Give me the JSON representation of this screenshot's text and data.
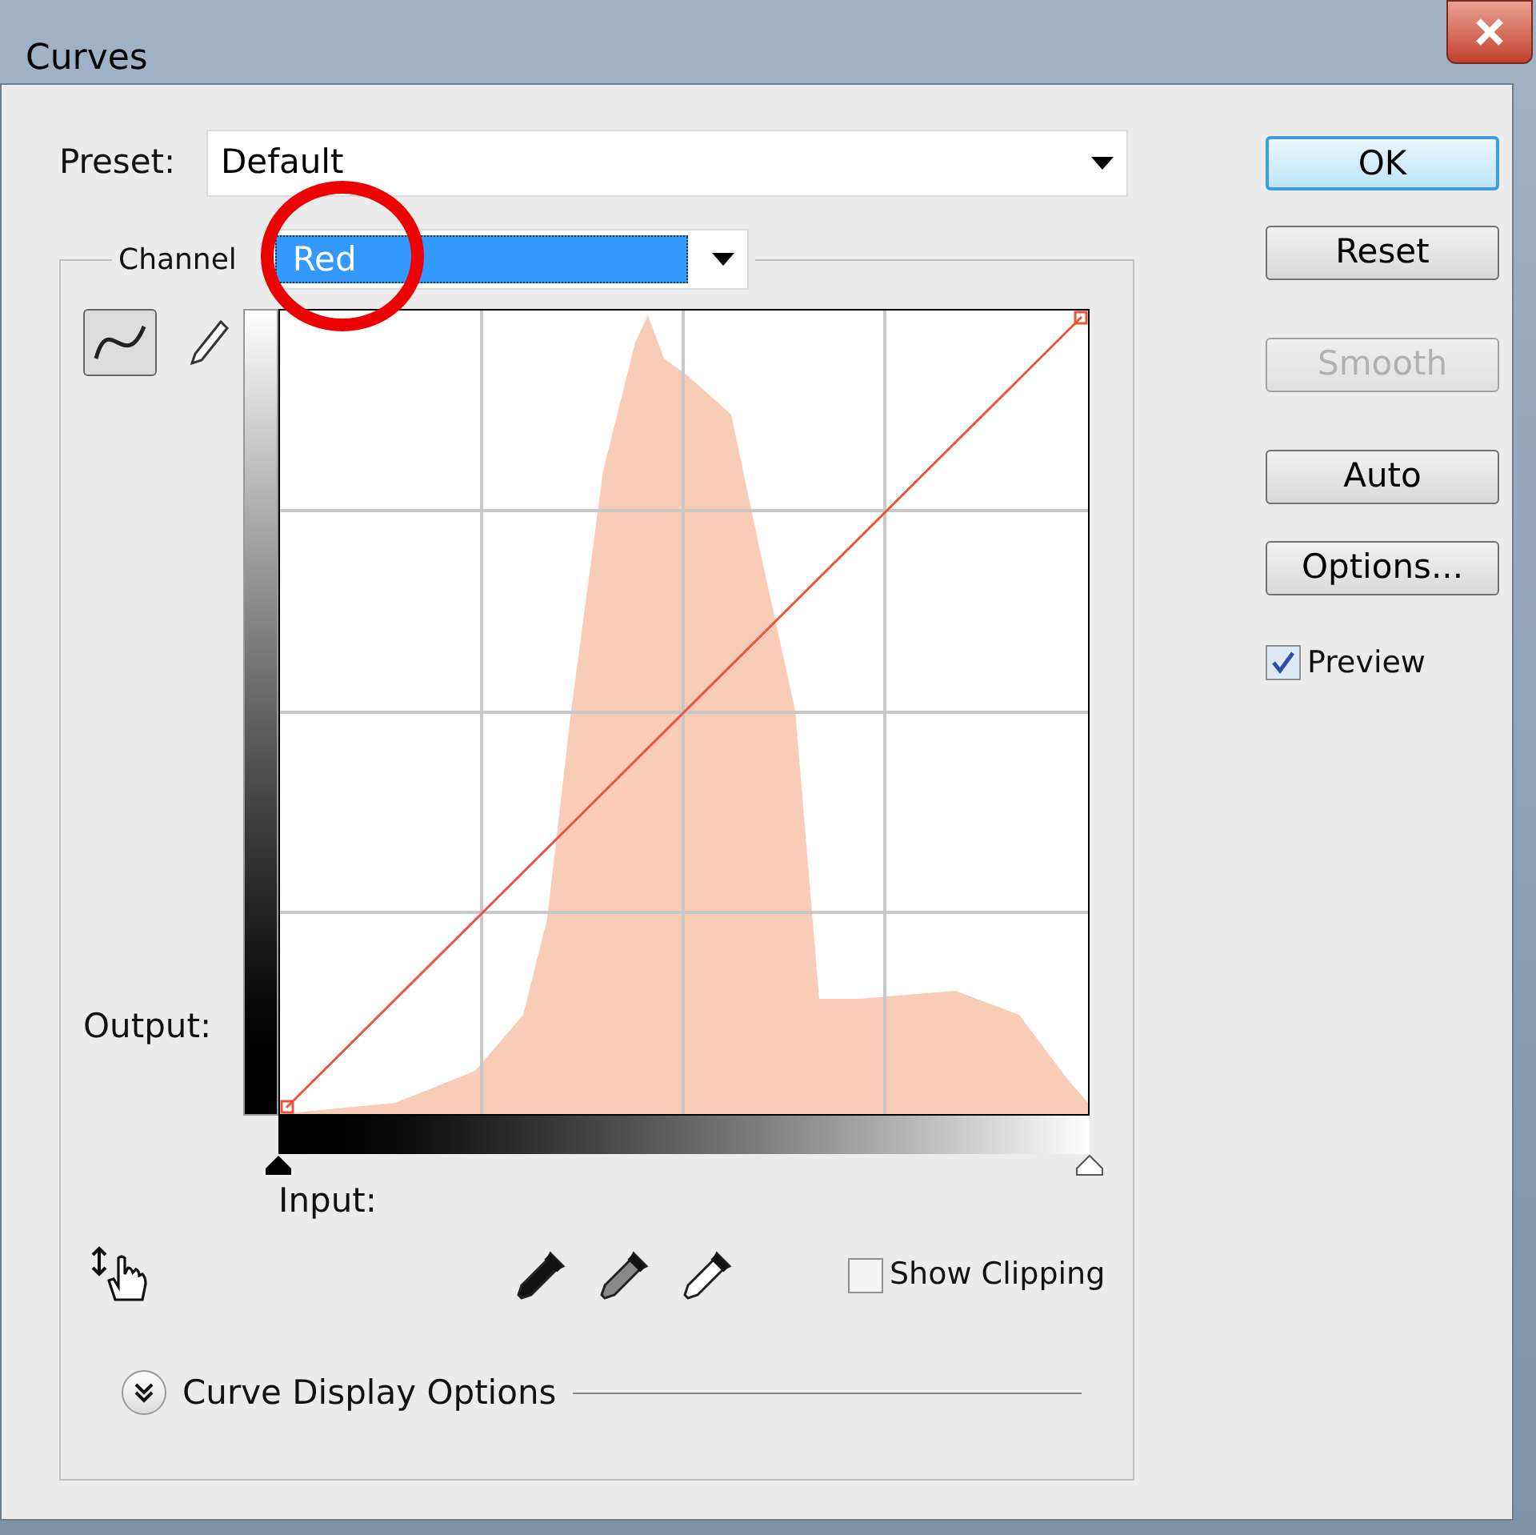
{
  "window": {
    "title": "Curves"
  },
  "preset": {
    "label": "Preset:",
    "value": "Default"
  },
  "channel": {
    "label": "Channel",
    "value": "Red"
  },
  "buttons": [
    {
      "label": "OK",
      "default": true,
      "disabled": false
    },
    {
      "label": "Reset",
      "default": false,
      "disabled": false
    },
    {
      "label": "Smooth",
      "default": false,
      "disabled": true
    },
    {
      "label": "Auto",
      "default": false,
      "disabled": false
    },
    {
      "label": "Options...",
      "default": false,
      "disabled": false
    }
  ],
  "preview": {
    "label": "Preview",
    "checked": true
  },
  "curve_tools": [
    {
      "kind": "curve",
      "selected": true
    },
    {
      "kind": "pencil",
      "selected": false
    }
  ],
  "output_label": "Output:",
  "input_label": "Input:",
  "show_clipping": {
    "label": "Show Clipping",
    "checked": false
  },
  "display_options": {
    "label": "Curve Display Options",
    "expanded": false
  }
}
